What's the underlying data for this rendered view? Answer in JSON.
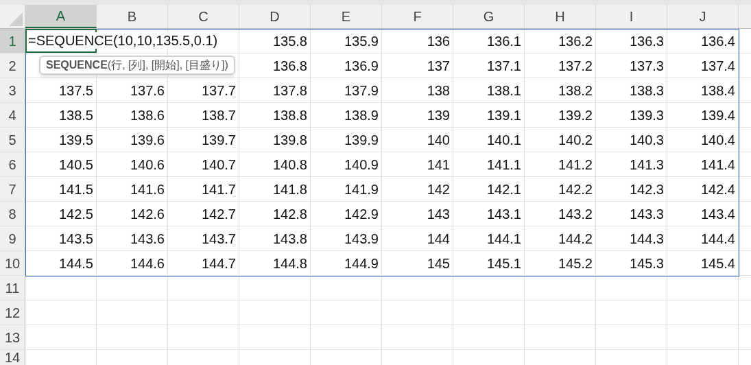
{
  "columns": [
    {
      "label": "A",
      "selected": true
    },
    {
      "label": "B",
      "selected": false
    },
    {
      "label": "C",
      "selected": false
    },
    {
      "label": "D",
      "selected": false
    },
    {
      "label": "E",
      "selected": false
    },
    {
      "label": "F",
      "selected": false
    },
    {
      "label": "G",
      "selected": false
    },
    {
      "label": "H",
      "selected": false
    },
    {
      "label": "I",
      "selected": false
    },
    {
      "label": "J",
      "selected": false
    }
  ],
  "rows": [
    {
      "header": "1",
      "selected": true,
      "cells": [
        "=SEQUENCE(10,10,135.5,0.1)",
        null,
        null,
        "135.8",
        "135.9",
        "136",
        "136.1",
        "136.2",
        "136.3",
        "136.4"
      ]
    },
    {
      "header": "2",
      "selected": false,
      "cells": [
        null,
        null,
        null,
        "136.8",
        "136.9",
        "137",
        "137.1",
        "137.2",
        "137.3",
        "137.4"
      ]
    },
    {
      "header": "3",
      "selected": false,
      "cells": [
        "137.5",
        "137.6",
        "137.7",
        "137.8",
        "137.9",
        "138",
        "138.1",
        "138.2",
        "138.3",
        "138.4"
      ]
    },
    {
      "header": "4",
      "selected": false,
      "cells": [
        "138.5",
        "138.6",
        "138.7",
        "138.8",
        "138.9",
        "139",
        "139.1",
        "139.2",
        "139.3",
        "139.4"
      ]
    },
    {
      "header": "5",
      "selected": false,
      "cells": [
        "139.5",
        "139.6",
        "139.7",
        "139.8",
        "139.9",
        "140",
        "140.1",
        "140.2",
        "140.3",
        "140.4"
      ]
    },
    {
      "header": "6",
      "selected": false,
      "cells": [
        "140.5",
        "140.6",
        "140.7",
        "140.8",
        "140.9",
        "141",
        "141.1",
        "141.2",
        "141.3",
        "141.4"
      ]
    },
    {
      "header": "7",
      "selected": false,
      "cells": [
        "141.5",
        "141.6",
        "141.7",
        "141.8",
        "141.9",
        "142",
        "142.1",
        "142.2",
        "142.3",
        "142.4"
      ]
    },
    {
      "header": "8",
      "selected": false,
      "cells": [
        "142.5",
        "142.6",
        "142.7",
        "142.8",
        "142.9",
        "143",
        "143.1",
        "143.2",
        "143.3",
        "143.4"
      ]
    },
    {
      "header": "9",
      "selected": false,
      "cells": [
        "143.5",
        "143.6",
        "143.7",
        "143.8",
        "143.9",
        "144",
        "144.1",
        "144.2",
        "144.3",
        "144.4"
      ]
    },
    {
      "header": "10",
      "selected": false,
      "cells": [
        "144.5",
        "144.6",
        "144.7",
        "144.8",
        "144.9",
        "145",
        "145.1",
        "145.2",
        "145.3",
        "145.4"
      ]
    },
    {
      "header": "11",
      "selected": false,
      "cells": []
    },
    {
      "header": "12",
      "selected": false,
      "cells": []
    },
    {
      "header": "13",
      "selected": false,
      "cells": []
    },
    {
      "header": "14",
      "selected": false,
      "cells": []
    }
  ],
  "formula_tooltip": "**SEQUENCE**(行, [列], [開始], [目盛り])"
}
